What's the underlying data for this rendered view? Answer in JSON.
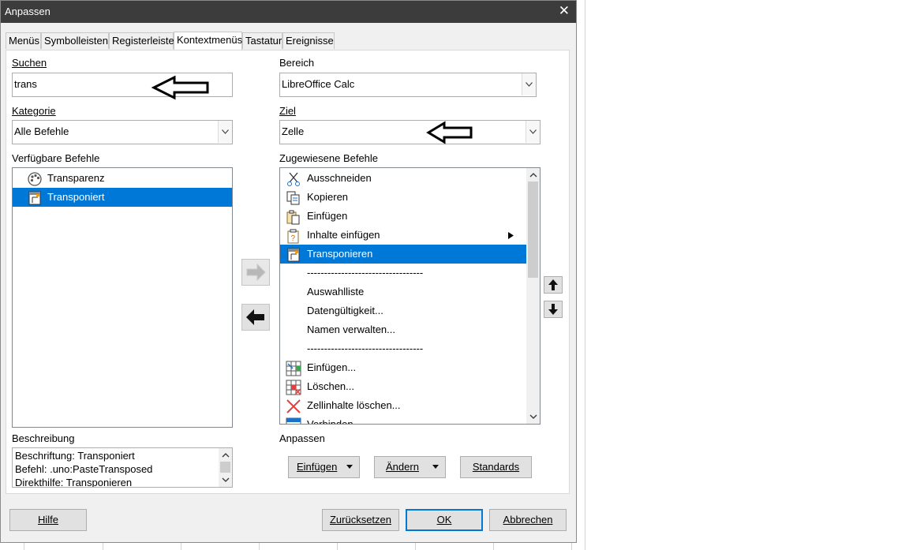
{
  "dialog": {
    "title": "Anpassen",
    "close_glyph": "✕"
  },
  "tabs": [
    {
      "label": "Menüs",
      "active": false
    },
    {
      "label": "Symbolleisten",
      "active": false
    },
    {
      "label": "Registerleiste",
      "active": false
    },
    {
      "label": "Kontextmenüs",
      "active": true
    },
    {
      "label": "Tastatur",
      "active": false
    },
    {
      "label": "Ereignisse",
      "active": false
    }
  ],
  "search": {
    "label": "Suchen",
    "value": "trans"
  },
  "category": {
    "label": "Kategorie",
    "value": "Alle Befehle"
  },
  "available": {
    "label": "Verfügbare Befehle",
    "items": [
      {
        "label": "Transparenz",
        "icon": "palette-icon",
        "selected": false
      },
      {
        "label": "Transponiert",
        "icon": "transpose-icon",
        "selected": true
      }
    ]
  },
  "scope": {
    "label": "Bereich",
    "value": "LibreOffice Calc"
  },
  "target": {
    "label": "Ziel",
    "value": "Zelle"
  },
  "assigned": {
    "label": "Zugewiesene Befehle",
    "items": [
      {
        "label": "Ausschneiden",
        "icon": "scissors-icon",
        "selected": false,
        "submenu": false
      },
      {
        "label": "Kopieren",
        "icon": "copy-icon",
        "selected": false,
        "submenu": false
      },
      {
        "label": "Einfügen",
        "icon": "paste-icon",
        "selected": false,
        "submenu": false
      },
      {
        "label": "Inhalte einfügen",
        "icon": "paste-special-icon",
        "selected": false,
        "submenu": true
      },
      {
        "label": "Transponieren",
        "icon": "transpose-icon",
        "selected": true,
        "submenu": false
      },
      {
        "label": "----------------------------------",
        "icon": "",
        "selected": false,
        "submenu": false
      },
      {
        "label": "Auswahlliste",
        "icon": "",
        "selected": false,
        "submenu": false
      },
      {
        "label": "Datengültigkeit...",
        "icon": "",
        "selected": false,
        "submenu": false
      },
      {
        "label": "Namen verwalten...",
        "icon": "",
        "selected": false,
        "submenu": false
      },
      {
        "label": "----------------------------------",
        "icon": "",
        "selected": false,
        "submenu": false
      },
      {
        "label": "Einfügen...",
        "icon": "insert-cells-icon",
        "selected": false,
        "submenu": false
      },
      {
        "label": "Löschen...",
        "icon": "delete-cells-icon",
        "selected": false,
        "submenu": false
      },
      {
        "label": "Zellinhalte löschen...",
        "icon": "clear-contents-icon",
        "selected": false,
        "submenu": false
      },
      {
        "label": "Verbinden",
        "icon": "merge-cells-icon",
        "selected": false,
        "submenu": false
      }
    ]
  },
  "description": {
    "label": "Beschreibung",
    "lines": [
      "Beschriftung: Transponiert",
      "Befehl: .uno:PasteTransposed",
      "Direkthilfe: Transponieren"
    ]
  },
  "customize": {
    "label": "Anpassen",
    "insert_label": "Einfügen",
    "modify_label": "Ändern",
    "defaults_label": "Standards"
  },
  "footer": {
    "help_label": "Hilfe",
    "reset_label": "Zurücksetzen",
    "ok_label": "OK",
    "cancel_label": "Abbrechen"
  },
  "colors": {
    "selection": "#0078d7",
    "titlebar": "#3c3c3c",
    "dialog_bg": "#f0f0f0"
  }
}
